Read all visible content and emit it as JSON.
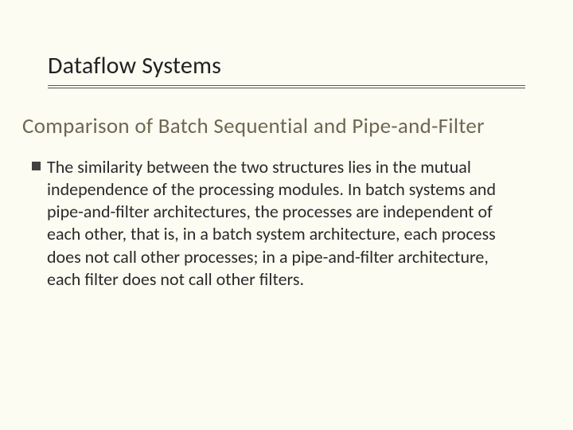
{
  "heading": "Dataflow Systems",
  "subheading": "Comparison of Batch Sequential and Pipe-and-Filter",
  "body": {
    "bullets": [
      "The similarity between the two structures lies in the mutual independence of the processing modules. In batch systems and pipe-and-filter architectures, the processes are independent of each other, that is, in a batch system architecture, each process does not call other processes; in a pipe-and-filter architecture, each filter does not call other filters."
    ]
  }
}
